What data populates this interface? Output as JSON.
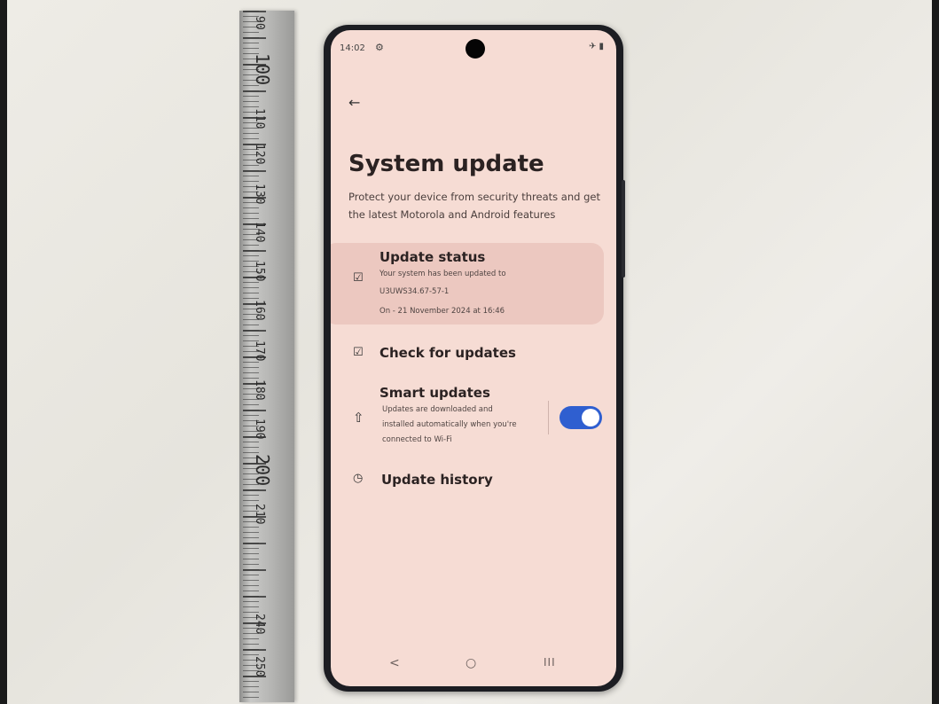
{
  "ruler": {
    "labels": [
      "90",
      "100",
      "110",
      "120",
      "130",
      "140",
      "150",
      "160",
      "170",
      "180",
      "190",
      "200",
      "210",
      "240",
      "250"
    ]
  },
  "status_bar": {
    "time": "14:02",
    "gear_icon": "⚙",
    "right_icons": "✈ ▮"
  },
  "app_bar": {
    "back_icon": "←"
  },
  "page": {
    "title": "System update",
    "subtitle": "Protect your device from security threats and get the latest Motorola and Android features"
  },
  "update_status": {
    "icon": "☑",
    "title": "Update status",
    "line1": "Your system has been updated to",
    "line2": "U3UWS34.67-57-1",
    "line3": "On - 21 November 2024 at 16:46"
  },
  "check_updates": {
    "icon": "☑",
    "label": "Check for updates"
  },
  "smart_updates": {
    "icon": "⇧",
    "title": "Smart updates",
    "description": "Updates are downloaded and installed automatically when you're connected to Wi-Fi",
    "enabled": true,
    "toggle_color": "#2f5fd0"
  },
  "update_history": {
    "icon": "◷",
    "label": "Update history"
  },
  "nav_bar": {
    "back": "<",
    "home": "○",
    "recents": "III"
  },
  "colors": {
    "screen_bg": "#f6dcd4",
    "card_bg": "#ecc8c0",
    "phone_body": "#1c1d22"
  }
}
